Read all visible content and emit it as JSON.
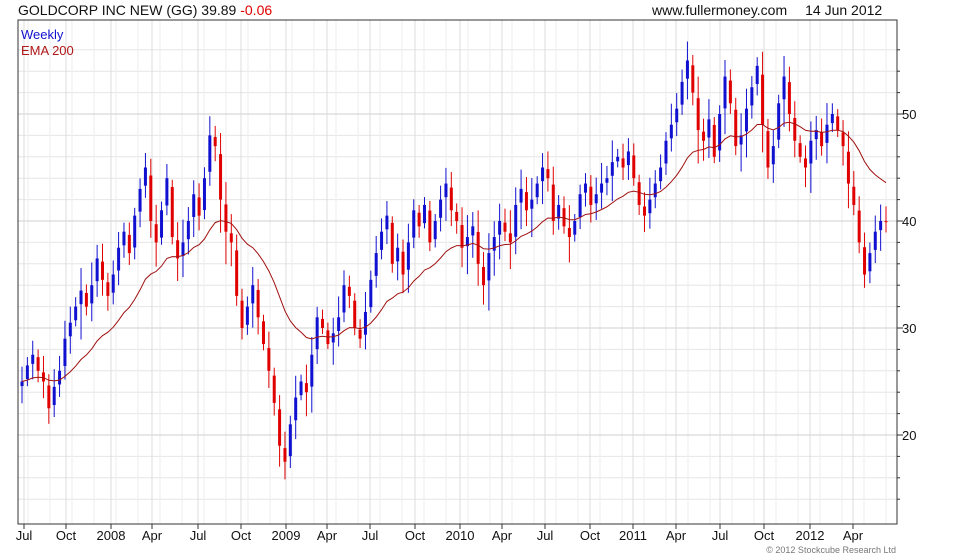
{
  "header": {
    "security": "GOLDCORP INC NEW (GG) 39.89",
    "change": "-0.06",
    "site": "www.fullermoney.com",
    "date": "14 Jun 2012"
  },
  "legend": {
    "weekly": "Weekly",
    "ema": "EMA 200"
  },
  "copyright": "© 2012 Stockcube Research Ltd",
  "colors": {
    "up": "#1010d0",
    "down": "#e00000",
    "ema": "#a01010",
    "grid": "#cfcfcf",
    "axis": "#333333"
  },
  "chart_data": {
    "type": "candlestick",
    "title": "GOLDCORP INC NEW (GG) 39.89 -0.06",
    "frequency": "Weekly",
    "y_ticks": [
      20,
      30,
      40,
      50
    ],
    "ylim": [
      13,
      58
    ],
    "x_tick_labels": [
      "Jul",
      "Oct",
      "2008",
      "Apr",
      "Jul",
      "Oct",
      "2009",
      "Apr",
      "Jul",
      "Oct",
      "2010",
      "Apr",
      "Jul",
      "Oct",
      "2011",
      "Apr",
      "Jul",
      "Oct",
      "2012",
      "Apr"
    ],
    "series": [
      {
        "name": "Weekly",
        "note": "approximate weekly closing prices, Jul 2007 - Jun 2012",
        "close": [
          25.0,
          26.5,
          27.5,
          26.0,
          25.0,
          22.5,
          24.5,
          26.0,
          29.0,
          30.5,
          32.0,
          33.5,
          32.0,
          34.0,
          36.5,
          34.5,
          33.0,
          35.0,
          37.5,
          39.0,
          37.0,
          40.5,
          43.0,
          45.0,
          40.0,
          38.0,
          41.0,
          44.0,
          38.5,
          36.5,
          38.0,
          40.0,
          42.5,
          40.5,
          44.0,
          48.0,
          47.0,
          42.0,
          39.0,
          38.0,
          33.0,
          30.0,
          32.0,
          34.0,
          31.0,
          28.5,
          26.0,
          23.0,
          19.0,
          17.5,
          21.0,
          23.5,
          25.0,
          24.0,
          27.5,
          31.0,
          30.0,
          28.5,
          29.5,
          31.0,
          34.0,
          33.0,
          30.0,
          29.0,
          31.5,
          34.5,
          37.0,
          39.0,
          40.5,
          36.0,
          37.5,
          35.0,
          38.0,
          41.0,
          39.5,
          41.5,
          38.0,
          40.0,
          42.0,
          43.5,
          41.0,
          40.0,
          37.5,
          38.5,
          39.5,
          36.0,
          34.0,
          37.0,
          38.5,
          40.0,
          39.0,
          38.0,
          41.5,
          43.0,
          41.0,
          42.0,
          43.5,
          45.0,
          44.0,
          40.0,
          41.5,
          39.5,
          38.5,
          40.0,
          42.5,
          43.5,
          41.5,
          42.5,
          43.5,
          44.0,
          45.5,
          46.0,
          45.0,
          46.5,
          44.0,
          41.5,
          40.5,
          42.0,
          43.5,
          45.0,
          47.5,
          49.0,
          50.5,
          53.0,
          55.0,
          52.0,
          48.5,
          47.5,
          49.5,
          46.0,
          50.0,
          53.5,
          51.0,
          47.0,
          48.0,
          50.5,
          52.5,
          54.5,
          49.0,
          45.0,
          47.0,
          51.0,
          53.5,
          50.0,
          47.5,
          46.0,
          45.0,
          47.5,
          48.5,
          47.0,
          49.0,
          50.0,
          48.5,
          47.0,
          43.5,
          41.5,
          38.0,
          35.0,
          37.0,
          39.0,
          40.0,
          39.89
        ]
      },
      {
        "name": "EMA 200",
        "values_note": "200-period exponential moving average of the weekly closes, rising from ~25 (2007) to ~49 (Oct 2011) and easing to ~44 (Jun 2012)"
      }
    ]
  }
}
